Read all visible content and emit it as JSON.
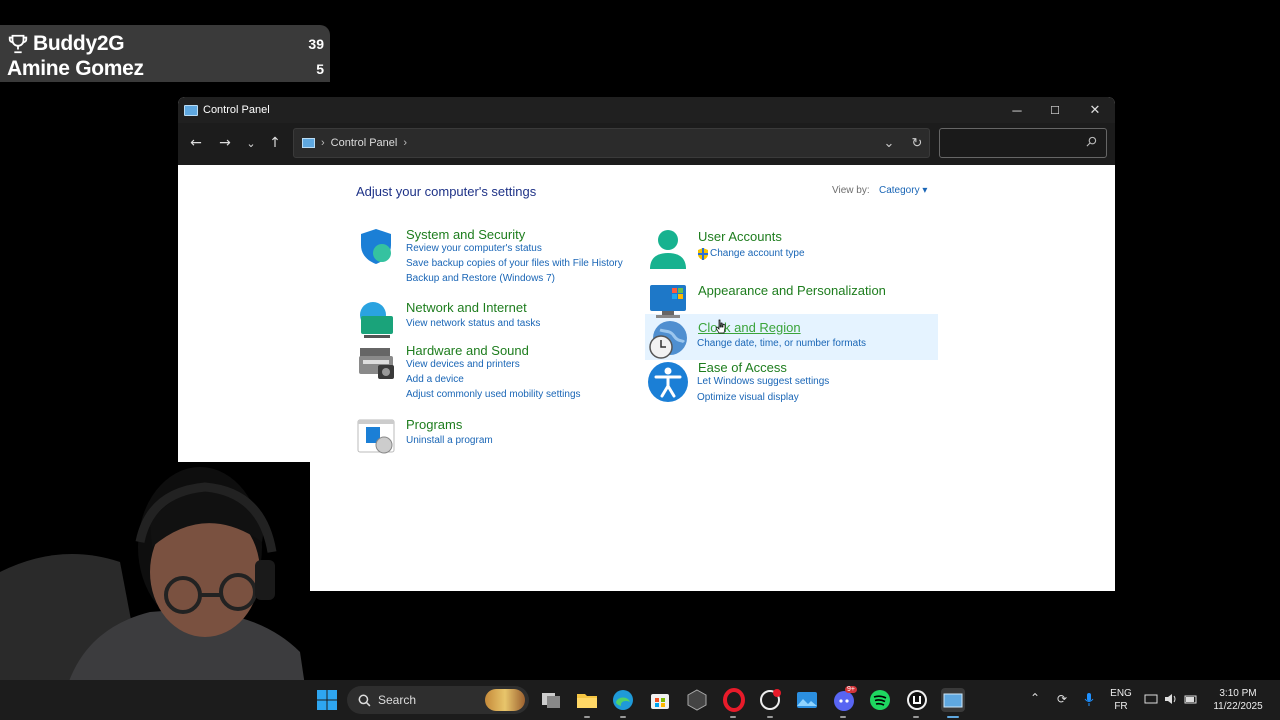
{
  "leaderboard": {
    "rows": [
      {
        "name": "Buddy2G",
        "score": "39"
      },
      {
        "name": "Amine Gomez",
        "score": "5"
      }
    ]
  },
  "window": {
    "title": "Control Panel",
    "controls": {
      "minimize": "─",
      "maximize": "☐",
      "close": "✕"
    },
    "nav": {
      "back": "←",
      "forward": "→",
      "recent": "⌄",
      "up": "↑"
    },
    "address": {
      "sep": "›",
      "crumb": "Control Panel",
      "sep2": "›",
      "dropdown": "⌄",
      "refresh": "↻"
    },
    "search": {
      "placeholder": ""
    }
  },
  "content": {
    "heading": "Adjust your computer's settings",
    "view_by_label": "View by:",
    "view_by_value": "Category ▾",
    "categories": [
      {
        "title": "System and Security",
        "links": [
          "Review your computer's status",
          "Save backup copies of your files with File History",
          "Backup and Restore (Windows 7)"
        ]
      },
      {
        "title": "Network and Internet",
        "links": [
          "View network status and tasks"
        ]
      },
      {
        "title": "Hardware and Sound",
        "links": [
          "View devices and printers",
          "Add a device",
          "Adjust commonly used mobility settings"
        ]
      },
      {
        "title": "Programs",
        "links": [
          "Uninstall a program"
        ]
      },
      {
        "title": "User Accounts",
        "links": [
          "Change account type"
        ]
      },
      {
        "title": "Appearance and Personalization",
        "links": []
      },
      {
        "title": "Clock and Region",
        "links": [
          "Change date, time, or number formats"
        ]
      },
      {
        "title": "Ease of Access",
        "links": [
          "Let Windows suggest settings",
          "Optimize visual display"
        ]
      }
    ]
  },
  "taskbar": {
    "search_label": "Search",
    "tray": {
      "lang_top": "ENG",
      "lang_bottom": "FR",
      "time": "3:10 PM",
      "date": "11/22/2025",
      "chevron": "⌃"
    },
    "badge": "9+"
  },
  "colors": {
    "accent_link": "#1a66b6",
    "category_title": "#1e7d1e",
    "heading": "#1e3287"
  }
}
